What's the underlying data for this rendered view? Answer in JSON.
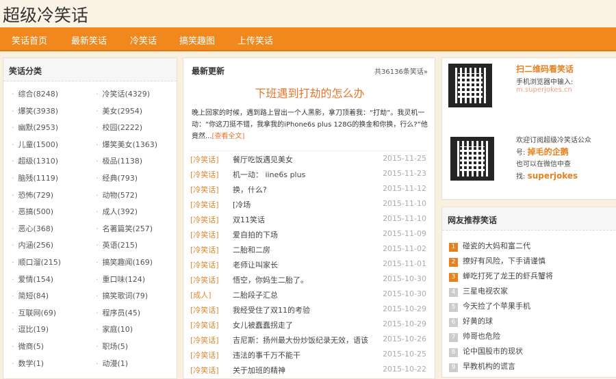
{
  "site_title": "超级冷笑话",
  "nav": [
    "笑话首页",
    "最新笑话",
    "冷笑话",
    "搞笑趣图",
    "上传笑话"
  ],
  "categories": {
    "title": "笑话分类",
    "items": [
      "综合(8248)",
      "冷笑话(4329)",
      "爆笑(3938)",
      "美女(2954)",
      "幽默(2953)",
      "校园(2222)",
      "儿童(1500)",
      "爆笑美女(1363)",
      "超级(1310)",
      "极品(1138)",
      "脑残(1119)",
      "经典(793)",
      "恐怖(729)",
      "动物(572)",
      "恶搞(500)",
      "成人(392)",
      "恶心(368)",
      "名著篇笑(257)",
      "内涵(256)",
      "英语(215)",
      "顺口溜(215)",
      "搞笑趣闻(169)",
      "爱情(154)",
      "重口味(124)",
      "简短(84)",
      "搞笑歌词(79)",
      "互联网(69)",
      "程序员(45)",
      "逗比(19)",
      "家庭(10)",
      "微商(5)",
      "职场(5)",
      "数学(1)",
      "动漫(1)"
    ]
  },
  "latest": {
    "title": "最新更新",
    "count": "共36136条笑话»",
    "featured_title": "下班遇到打劫的怎么办",
    "featured_excerpt": "晚上回家的时候，遇到路上冒出一个人黑影，拿刀顶着我：“打劫”。我灵机一动：“你这刀挺不错，我拿我的iPhone6s plus 128G的换金和你换，行么?”他竟然...",
    "read_more": "[查看全文]",
    "rows": [
      {
        "tag": "[冷笑话]",
        "title": "餐厅吃饭遇见美女",
        "date": "2015-11-25"
      },
      {
        "tag": "[冷笑话]",
        "title": "机一动：  iine6s plus",
        "date": "2015-11-23"
      },
      {
        "tag": "[冷笑话]",
        "title": "换，什么?",
        "date": "2015-11-12"
      },
      {
        "tag": "[冷笑话]",
        "title": "[冷场",
        "date": "2015-11-10"
      },
      {
        "tag": "[冷笑话]",
        "title": "双11笑话",
        "date": "2015-11-10"
      },
      {
        "tag": "[冷笑话]",
        "title": "爱自拍的下场",
        "date": "2015-11-09"
      },
      {
        "tag": "[冷笑话]",
        "title": "二胎和二房",
        "date": "2015-11-02"
      },
      {
        "tag": "[冷笑话]",
        "title": "老师让叫家长",
        "date": "2015-11-01"
      },
      {
        "tag": "[冷笑话]",
        "title": "悟空，你妈生二胎了。",
        "date": "2015-10-30"
      },
      {
        "tag": "[成人]",
        "title": "二胎段子汇总",
        "date": "2015-10-30"
      },
      {
        "tag": "[冷笑话]",
        "title": "我经受住了双11的考验",
        "date": "2015-10-29"
      },
      {
        "tag": "[冷笑话]",
        "title": "女儿被蠢蠢拐走了",
        "date": "2015-10-29"
      },
      {
        "tag": "[冷笑话]",
        "title": "吉尼斯：扬州最大份炒饭纪录无效，语该",
        "date": "2015-10-26"
      },
      {
        "tag": "[冷笑话]",
        "title": "违法的事千万不能干",
        "date": "2015-10-25"
      },
      {
        "tag": "[冷笑话]",
        "title": "关于加班的精神",
        "date": "2015-10-22"
      }
    ]
  },
  "qr": {
    "scan_title": "扫二维码看笑话",
    "scan_hint": "手机浏览器中输入:",
    "mobile_url": "m.superjokes.cn",
    "wechat_line1": "欢迎订阅超级冷笑话公众",
    "wechat_line2_prefix": "号:",
    "wechat_name": "掉毛的企鹅",
    "wechat_line3": "也可以在微信中查",
    "wechat_line4_prefix": "找:",
    "wechat_id": "superjokes"
  },
  "recommended": {
    "title": "网友推荐笑话",
    "items": [
      "碰瓷的大妈和富二代",
      "撩好有风险，下手请谨慎",
      "蝉吃打死了龙王的虾兵蟹将",
      "三星电视农家",
      "今天捡了个苹果手机",
      "好黄的球",
      "帅哥也危险",
      "论中国股市的现状",
      "早教机构的谎言"
    ]
  }
}
